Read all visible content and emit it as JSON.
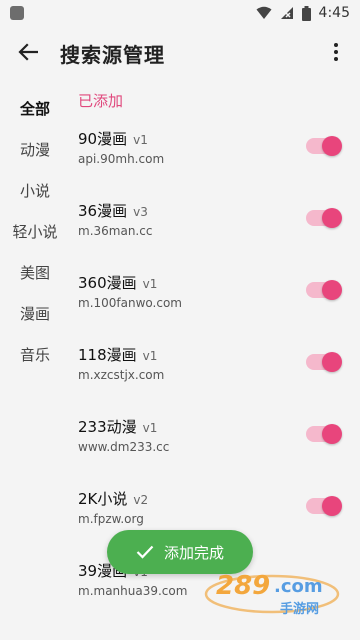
{
  "status_bar": {
    "time": "4:45"
  },
  "header": {
    "title": "搜索源管理"
  },
  "sidebar": {
    "items": [
      {
        "label": "全部",
        "active": true
      },
      {
        "label": "动漫",
        "active": false
      },
      {
        "label": "小说",
        "active": false
      },
      {
        "label": "轻小说",
        "active": false
      },
      {
        "label": "美图",
        "active": false
      },
      {
        "label": "漫画",
        "active": false
      },
      {
        "label": "音乐",
        "active": false
      }
    ]
  },
  "content": {
    "section_label": "已添加",
    "sources": [
      {
        "name": "90漫画",
        "version": "v1",
        "url": "api.90mh.com",
        "enabled": true
      },
      {
        "name": "36漫画",
        "version": "v3",
        "url": "m.36man.cc",
        "enabled": true
      },
      {
        "name": "360漫画",
        "version": "v1",
        "url": "m.100fanwo.com",
        "enabled": true
      },
      {
        "name": "118漫画",
        "version": "v1",
        "url": "m.xzcstjx.com",
        "enabled": true
      },
      {
        "name": "233动漫",
        "version": "v1",
        "url": "www.dm233.cc",
        "enabled": true
      },
      {
        "name": "2K小说",
        "version": "v2",
        "url": "m.fpzw.org",
        "enabled": true
      },
      {
        "name": "39漫画",
        "version": "v1",
        "url": "m.manhua39.com",
        "enabled": true
      }
    ]
  },
  "toast": {
    "text": "添加完成"
  },
  "watermark": {
    "text": "289.com 手游网"
  },
  "colors": {
    "accent": "#e8457c",
    "toast_bg": "#4caf50",
    "section_label": "#e0487d"
  }
}
